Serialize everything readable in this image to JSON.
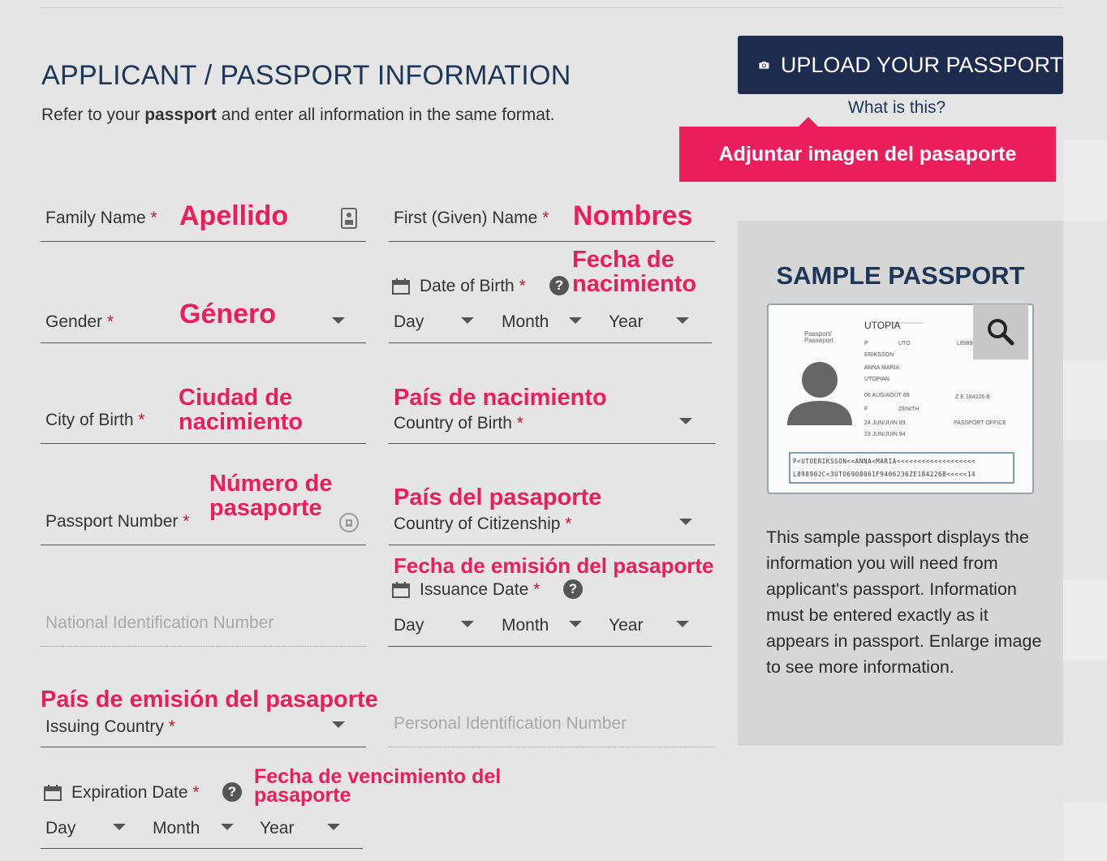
{
  "header": {
    "title": "APPLICANT / PASSPORT INFORMATION",
    "subtitle_before": "Refer to your ",
    "subtitle_bold": "passport",
    "subtitle_after": " and enter all information in the same format."
  },
  "upload": {
    "button_label": "UPLOAD YOUR PASSPORT",
    "what_is_this": "What is this?",
    "callout": "Adjuntar imagen del pasaporte"
  },
  "required_mark": "*",
  "fields": {
    "family_name": {
      "label": "Family Name",
      "callout": "Apellido"
    },
    "first_name": {
      "label": "First (Given) Name",
      "callout": "Nombres"
    },
    "gender": {
      "label": "Gender",
      "callout": "Género"
    },
    "date_of_birth": {
      "label": "Date of Birth",
      "callout_line1": "Fecha de",
      "callout_line2": "nacimiento"
    },
    "city_of_birth": {
      "label": "City of Birth",
      "callout_line1": "Ciudad de",
      "callout_line2": "nacimiento"
    },
    "country_of_birth": {
      "label": "Country of Birth",
      "callout": "País de nacimiento"
    },
    "passport_number": {
      "label": "Passport Number",
      "callout_line1": "Número de",
      "callout_line2": "pasaporte"
    },
    "country_of_citizenship": {
      "label": "Country of Citizenship",
      "callout": "País del pasaporte"
    },
    "issuance_date": {
      "label": "Issuance Date",
      "callout": "Fecha de emisión del pasaporte"
    },
    "national_id": {
      "placeholder": "National Identification Number"
    },
    "issuing_country": {
      "label": "Issuing Country",
      "callout": "País de emisión del pasaporte"
    },
    "personal_id": {
      "placeholder": "Personal Identification Number"
    },
    "expiration_date": {
      "label": "Expiration Date",
      "callout_line1": "Fecha de vencimiento del",
      "callout_line2": "pasaporte"
    }
  },
  "date_parts": {
    "day": "Day",
    "month": "Month",
    "year": "Year"
  },
  "sample": {
    "title": "SAMPLE PASSPORT",
    "description": "This sample passport displays the information you will need from applicant's passport. Information must be entered exactly as it appears in passport. Enlarge image to see more information.",
    "passport": {
      "country": "UTOPIA",
      "doc_label_line1": "Passport/",
      "doc_label_line2": "Passeport",
      "type": "P",
      "code": "UTO",
      "number": "L898902C",
      "surname": "ERIKSSON",
      "given_names_line1": "ANNA MARIA",
      "nationality": "UTOPIAN",
      "dob": "06 AUG/AOÛT 69",
      "personal_no": "Z E 184226 B",
      "sex": "F",
      "place_of_birth": "ZENITH",
      "issue_date": "24 JUN/JUIN 89",
      "authority": "PASSPORT OFFICE",
      "expiry_date": "23 JUN/JUIN 94",
      "mrz1": "P<UTOERIKSSON<<ANNA<MARIA<<<<<<<<<<<<<<<<<<<",
      "mrz2": "L898902C<3UTO6908061F9406236ZE184226B<<<<<14"
    }
  },
  "colors": {
    "navy": "#1d2b4f",
    "pink": "#e91e5a",
    "required": "#c0172e"
  }
}
